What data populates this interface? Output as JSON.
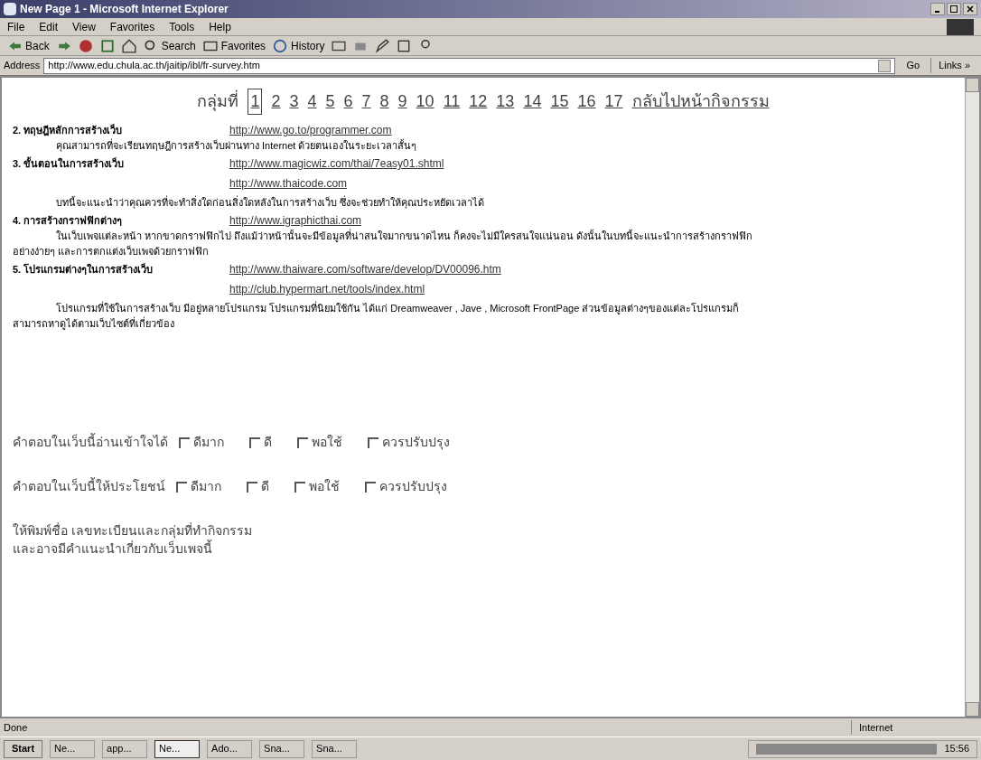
{
  "window": {
    "title": "New Page 1 - Microsoft Internet Explorer"
  },
  "menu": [
    "File",
    "Edit",
    "View",
    "Favorites",
    "Tools",
    "Help"
  ],
  "toolbar": [
    {
      "kind": "back",
      "label": "Back"
    },
    {
      "kind": "forward"
    },
    {
      "kind": "stop"
    },
    {
      "kind": "refresh"
    },
    {
      "kind": "home"
    },
    {
      "kind": "search",
      "label": "Search"
    },
    {
      "kind": "favorites",
      "label": "Favorites"
    },
    {
      "kind": "history",
      "label": "History"
    },
    {
      "kind": "mail"
    },
    {
      "kind": "print"
    },
    {
      "kind": "edit"
    },
    {
      "kind": "discuss"
    },
    {
      "kind": "messenger"
    }
  ],
  "address": {
    "label": "Address",
    "value": "http://www.edu.chula.ac.th/jaitip/ibl/fr-survey.htm",
    "go": "Go",
    "links": "Links »"
  },
  "nav": {
    "label": "กลุ่มที่",
    "pages": [
      {
        "label": "1",
        "selected": true
      },
      {
        "label": "2",
        "selected": false
      },
      {
        "label": "3",
        "selected": false
      },
      {
        "label": "4",
        "selected": false
      },
      {
        "label": "5",
        "selected": false
      },
      {
        "label": "6",
        "selected": false
      },
      {
        "label": "7",
        "selected": false
      },
      {
        "label": "8",
        "selected": false
      },
      {
        "label": "9",
        "selected": false
      },
      {
        "label": "10",
        "selected": false
      },
      {
        "label": "11",
        "selected": false
      },
      {
        "label": "12",
        "selected": false
      },
      {
        "label": "13",
        "selected": false
      },
      {
        "label": "14",
        "selected": false
      },
      {
        "label": "15",
        "selected": false
      },
      {
        "label": "16",
        "selected": false
      },
      {
        "label": "17",
        "selected": false
      }
    ],
    "back": "กลับไปหน้ากิจกรรม"
  },
  "topics": [
    {
      "number": "2.",
      "title": "ทฤษฎีหลักการสร้างเว็บ",
      "links": [
        "http://www.go.to/programmer.com"
      ],
      "description": "คุณสามารถที่จะเรียนทฤษฎีการสร้างเว็บผ่านทาง Internet ด้วยตนเองในระยะเวลาสั้นๆ"
    },
    {
      "number": "3.",
      "title": "ขั้นตอนในการสร้างเว็บ",
      "links": [
        "http://www.magicwiz.com/thai/7easy01.shtml",
        "http://www.thaicode.com"
      ],
      "description": "บทนี้จะแนะนำว่าคุณควรที่จะทำสิ่งใดก่อนสิ่งใดหลังในการสร้างเว็บ ซึ่งจะช่วยทำให้คุณประหยัดเวลาได้"
    },
    {
      "number": "4.",
      "title": "การสร้างกราฟฟิกต่างๆ",
      "links": [
        "http://www.igraphicthai.com"
      ],
      "description": "ในเว็บเพจแต่ละหน้า หากขาดกราฟฟิกไป ถึงแม้ว่าหน้านั้นจะมีข้อมูลที่น่าสนใจมากขนาดไหน ก็คงจะไม่มีใครสนใจแน่นอน ดังนั้นในบทนี้จะแนะนำการสร้างกราฟฟิกอย่างง่ายๆ และการตกแต่งเว็บเพจด้วยกราฟฟิก"
    },
    {
      "number": "5.",
      "title": "โปรแกรมต่างๆในการสร้างเว็บ",
      "links": [
        "http://www.thaiware.com/software/develop/DV00096.htm",
        "http://club.hypermart.net/tools/index.html"
      ],
      "description": "โปรแกรมที่ใช้ในการสร้างเว็บ มีอยู่หลายโปรแกรม โปรแกรมที่นิยมใช้กัน ได้แก่ Dreamweaver , Jave , Microsoft FrontPage ส่วนข้อมูลต่างๆของแต่ละโปรแกรมก็สามารถหาดูได้ตามเว็บไซต์ที่เกี่ยวข้อง"
    }
  ],
  "questions": [
    {
      "label": "คำตอบในเว็บนี้อ่านเข้าใจได้",
      "options": [
        {
          "label": "ดีมาก",
          "checked": false
        },
        {
          "label": "ดี",
          "checked": false
        },
        {
          "label": "พอใช้",
          "checked": false
        },
        {
          "label": "ควรปรับปรุง",
          "checked": false
        }
      ]
    },
    {
      "label": "คำตอบในเว็บนี้ให้ประโยชน์",
      "options": [
        {
          "label": "ดีมาก",
          "checked": false
        },
        {
          "label": "ดี",
          "checked": false
        },
        {
          "label": "พอใช้",
          "checked": false
        },
        {
          "label": "ควรปรับปรุง",
          "checked": false
        }
      ]
    }
  ],
  "instructions": [
    "ให้พิมพ์ชื่อ เลขทะเบียนและกลุ่มที่ทำกิจกรรม",
    "และอาจมีคำแนะนำเกี่ยวกับเว็บเพจนี้"
  ],
  "status_bar": {
    "text": "Done",
    "zone": "Internet"
  },
  "taskbar": {
    "start": "Start",
    "tasks": [
      {
        "label": "Ne...",
        "selected": false
      },
      {
        "label": "app...",
        "selected": false
      },
      {
        "label": "Ne...",
        "selected": true
      },
      {
        "label": "Ado...",
        "selected": false
      },
      {
        "label": "Sna...",
        "selected": false
      },
      {
        "label": "Sna...",
        "selected": false
      }
    ],
    "clock": "15:56"
  }
}
